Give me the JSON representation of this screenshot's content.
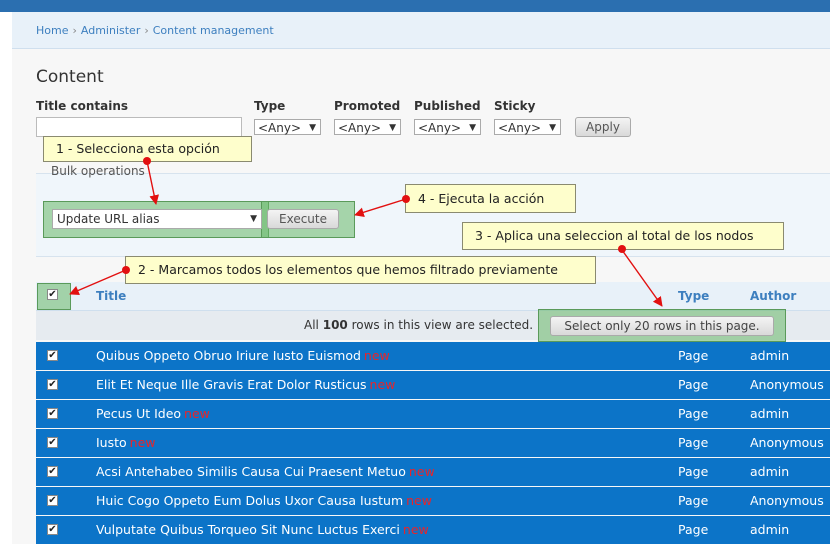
{
  "breadcrumb": [
    "Home",
    "Administer",
    "Content management"
  ],
  "page_title": "Content",
  "filters": {
    "title_label": "Title contains",
    "title_value": "",
    "type_label": "Type",
    "type_value": "<Any>",
    "promoted_label": "Promoted",
    "promoted_value": "<Any>",
    "published_label": "Published",
    "published_value": "<Any>",
    "sticky_label": "Sticky",
    "sticky_value": "<Any>",
    "apply_label": "Apply"
  },
  "bulk": {
    "legend": "Bulk operations",
    "operation": "Update URL alias",
    "execute_label": "Execute"
  },
  "callouts": [
    "1 - Selecciona esta opción",
    "2 - Marcamos todos los elementos que hemos filtrado previamente",
    "3 - Aplica una seleccion al total de los nodos",
    "4 - Ejecuta la acción"
  ],
  "table": {
    "headers": {
      "title": "Title",
      "type": "Type",
      "author": "Author"
    },
    "selection": {
      "prefix": "All",
      "count": "100",
      "suffix": "rows in this view are selected.",
      "button": "Select only 20 rows in this page."
    },
    "new_label": "new",
    "rows": [
      {
        "title": "Quibus Oppeto Obruo Iriure Iusto Euismod",
        "type": "Page",
        "author": "admin",
        "checked": true
      },
      {
        "title": "Elit Et Neque Ille Gravis Erat Dolor Rusticus",
        "type": "Page",
        "author": "Anonymous",
        "checked": true
      },
      {
        "title": "Pecus Ut Ideo",
        "type": "Page",
        "author": "admin",
        "checked": true
      },
      {
        "title": "Iusto",
        "type": "Page",
        "author": "Anonymous",
        "checked": true
      },
      {
        "title": "Acsi Antehabeo Similis Causa Cui Praesent Metuo",
        "type": "Page",
        "author": "admin",
        "checked": true
      },
      {
        "title": "Huic Cogo Oppeto Eum Dolus Uxor Causa Iustum",
        "type": "Page",
        "author": "Anonymous",
        "checked": true
      },
      {
        "title": "Vulputate Quibus Torqueo Sit Nunc Luctus Exerci",
        "type": "Page",
        "author": "admin",
        "checked": true
      }
    ]
  },
  "colors": {
    "row_selected": "#0c74c8",
    "callout_bg": "#fefecc",
    "annotation_red": "#e21010",
    "highlight_green": "#68b868"
  }
}
